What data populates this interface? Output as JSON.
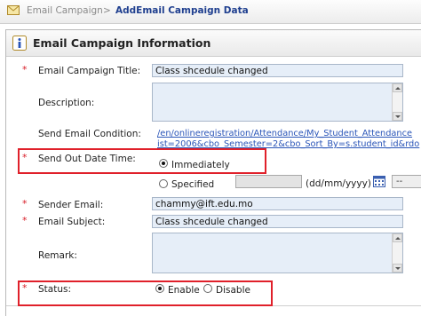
{
  "breadcrumb": {
    "item1": "Email Campaign",
    "separator": ">",
    "item2": "AddEmail Campaign Data"
  },
  "panel": {
    "title": "Email Campaign Information"
  },
  "form": {
    "campaign_title": {
      "label": "Email Campaign Title:",
      "value": "Class shcedule changed"
    },
    "description": {
      "label": "Description:",
      "value": ""
    },
    "send_condition": {
      "label": "Send Email Condition:",
      "line1": "/en/onlineregistration/Attendance/My_Student_Attendance",
      "line2": "ist=2006&cbo_Semester=2&cbo_Sort_By=s.student_id&rdo"
    },
    "send_out": {
      "label": "Send Out Date Time:",
      "immediately": "Immediately",
      "specified": "Specified",
      "date_format": "(dd/mm/yyyy)",
      "time_select": "--",
      "selected": "Immediately"
    },
    "sender_email": {
      "label": "Sender Email:",
      "value": "chammy@ift.edu.mo"
    },
    "email_subject": {
      "label": "Email Subject:",
      "value": "Class shcedule changed"
    },
    "remark": {
      "label": "Remark:",
      "value": ""
    },
    "status": {
      "label": "Status:",
      "enable": "Enable",
      "disable": "Disable",
      "selected": "Enable"
    },
    "required_mark": "*"
  },
  "colors": {
    "required": "#d8202a",
    "highlight": "#e0202a",
    "link": "#2a55b8",
    "breadcrumb_active": "#1f3f8f",
    "input_bg": "#e6eef8"
  }
}
